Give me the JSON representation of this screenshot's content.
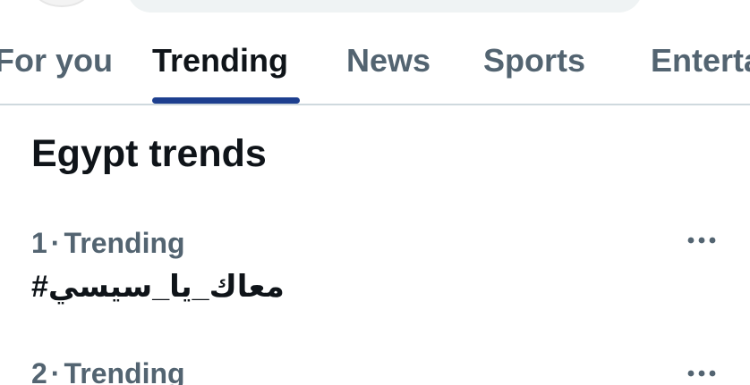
{
  "tabs": [
    {
      "label": "For you",
      "active": false
    },
    {
      "label": "Trending",
      "active": true
    },
    {
      "label": "News",
      "active": false
    },
    {
      "label": "Sports",
      "active": false
    },
    {
      "label": "Entertainment",
      "active": false
    }
  ],
  "section": {
    "title": "Egypt trends"
  },
  "trends": [
    {
      "rank": "1",
      "separator": "·",
      "category": "Trending",
      "name": "#معاك_يا_سيسي",
      "more_icon": "more-horizontal-icon"
    },
    {
      "rank": "2",
      "separator": "·",
      "category": "Trending",
      "name": "",
      "more_icon": "more-horizontal-icon"
    }
  ],
  "colors": {
    "accent": "#1d3f8f",
    "primary_text": "#0f1419",
    "secondary_text": "#536471",
    "divider": "#cfd9de",
    "search_bg": "#eff3f4"
  }
}
